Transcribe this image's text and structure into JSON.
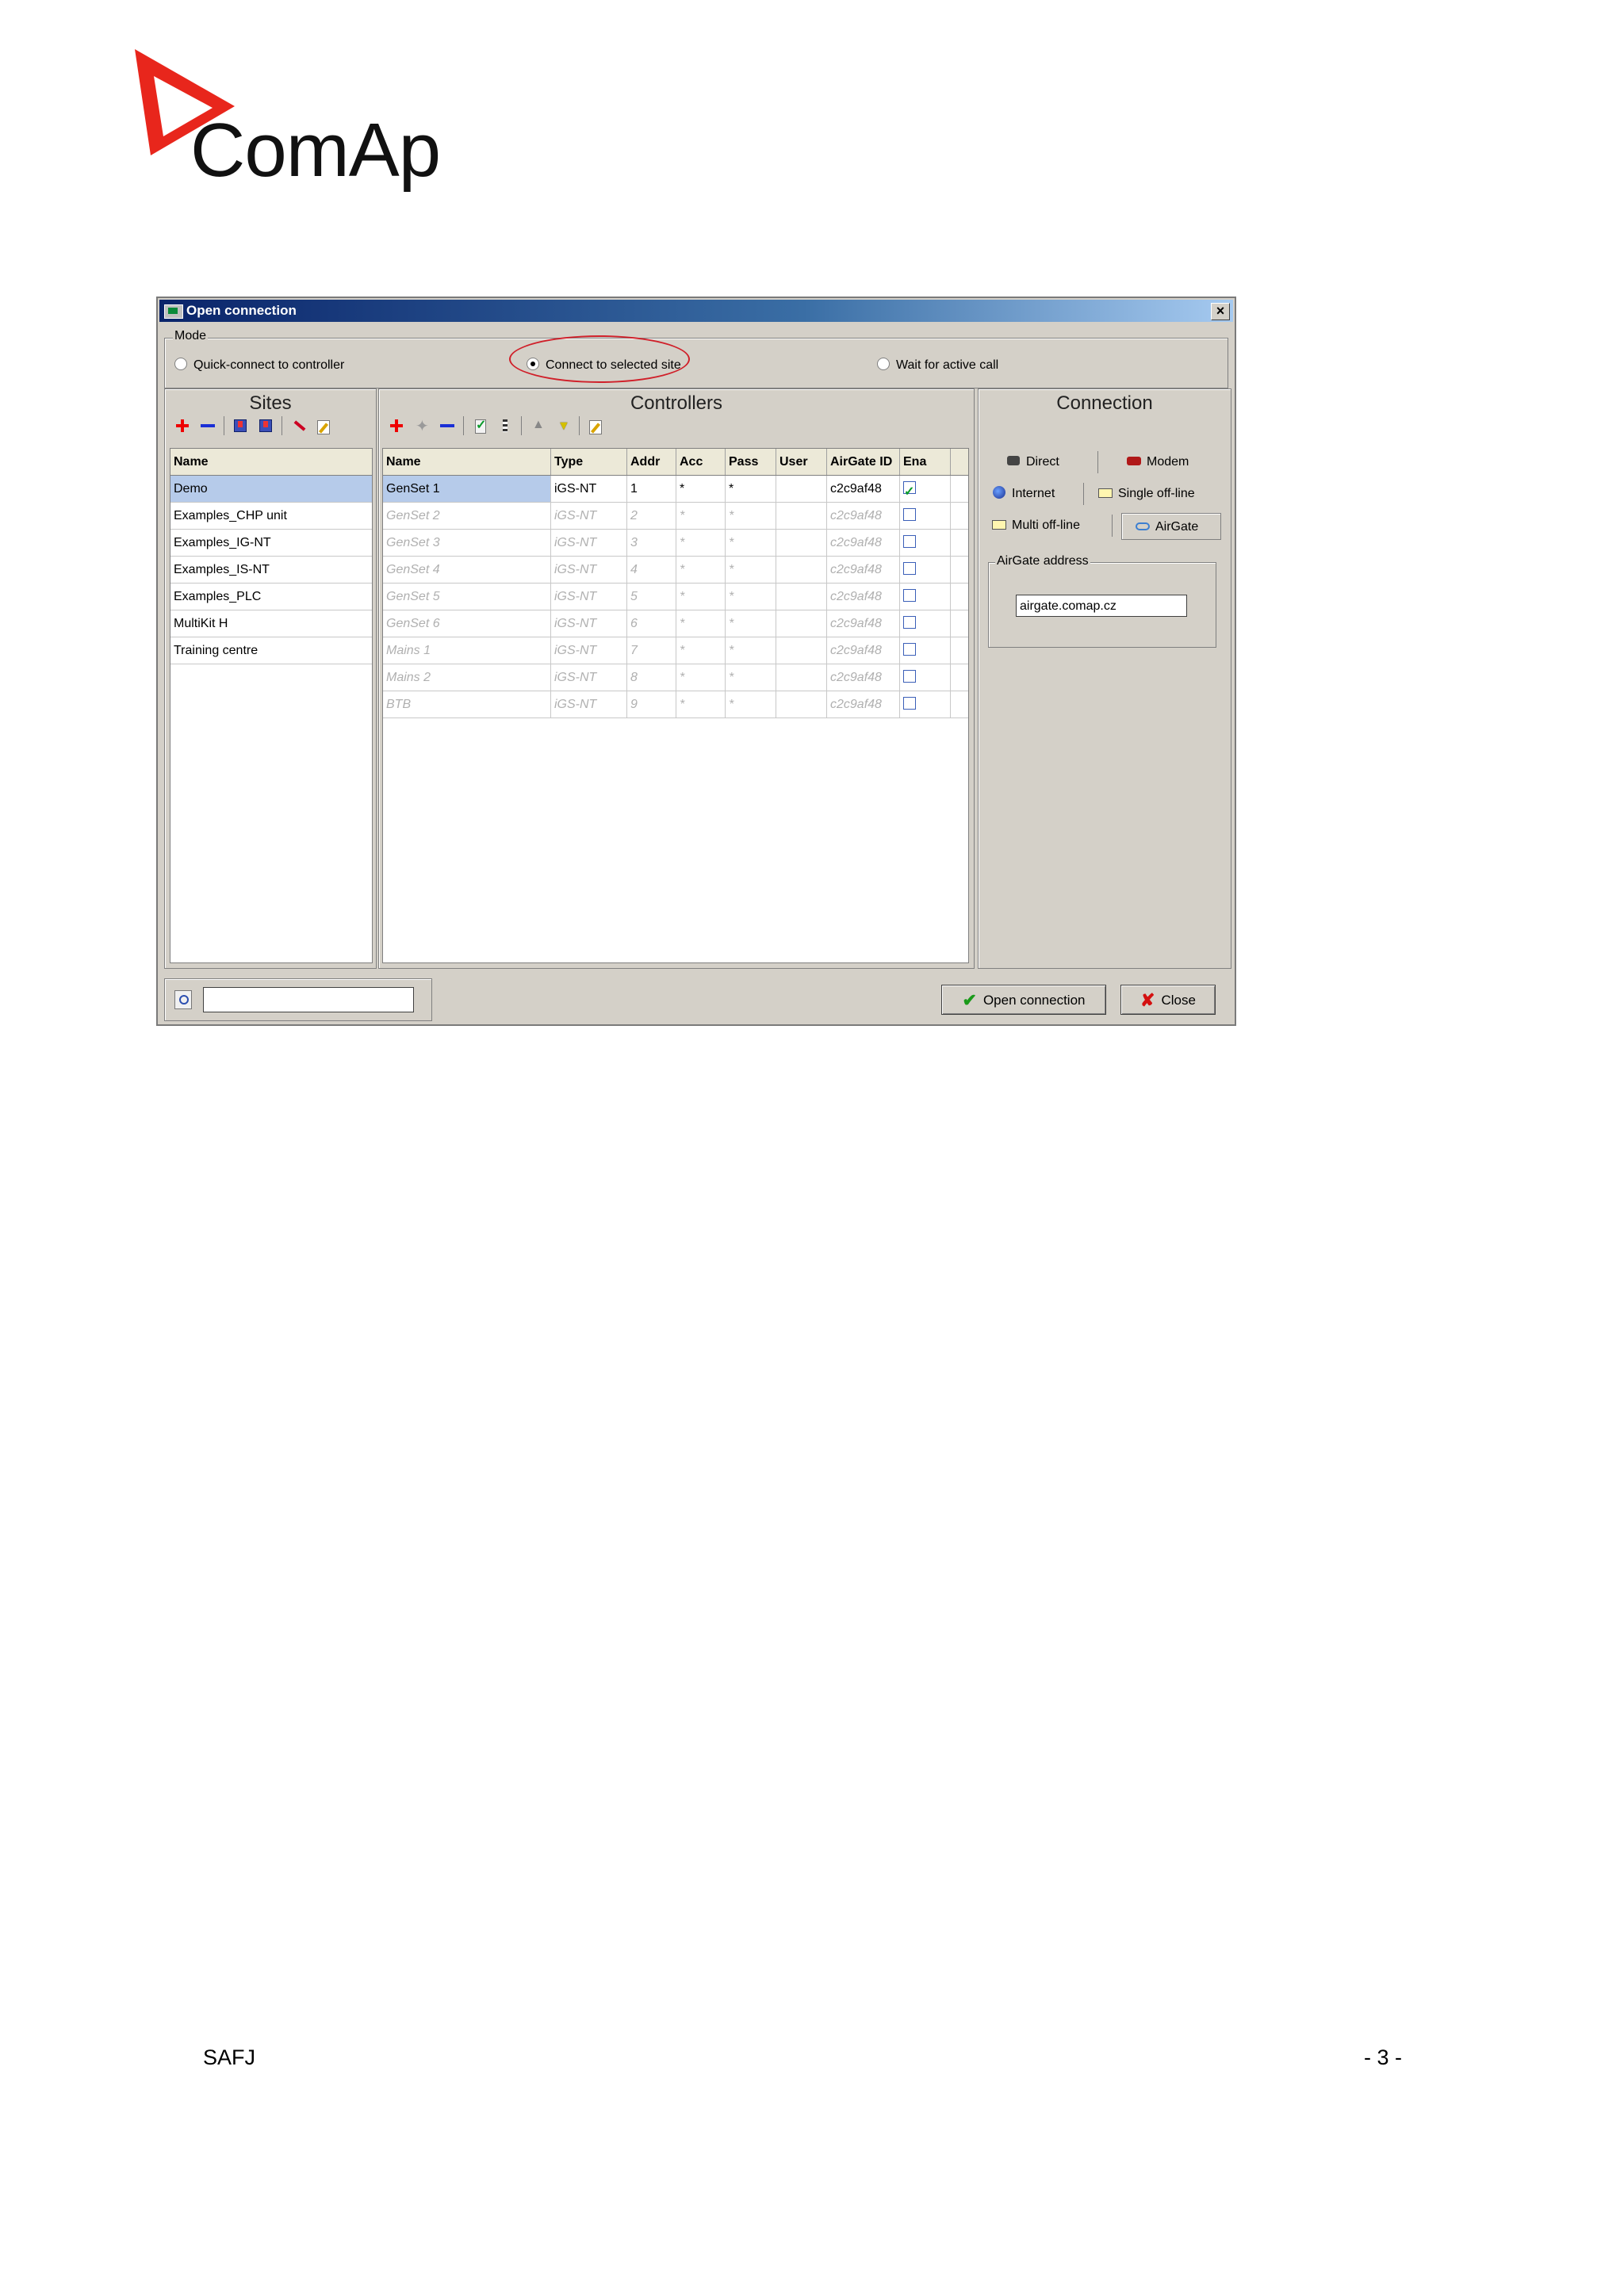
{
  "logo": {
    "text": "ComAp"
  },
  "dialog": {
    "title": "Open connection",
    "mode": {
      "legend": "Mode",
      "options": [
        {
          "label": "Quick-connect to controller",
          "selected": false
        },
        {
          "label": "Connect to selected site",
          "selected": true
        },
        {
          "label": "Wait for active call",
          "selected": false
        }
      ]
    },
    "sites": {
      "title": "Sites",
      "header": "Name",
      "items": [
        "Demo",
        "Examples_CHP unit",
        "Examples_IG-NT",
        "Examples_IS-NT",
        "Examples_PLC",
        "MultiKit H",
        "Training centre"
      ],
      "selected_index": 0
    },
    "controllers": {
      "title": "Controllers",
      "columns": [
        "Name",
        "Type",
        "Addr",
        "Acc",
        "Pass",
        "User",
        "AirGate ID",
        "Ena"
      ],
      "rows": [
        {
          "name": "GenSet 1",
          "type": "iGS-NT",
          "addr": "1",
          "acc": "*",
          "pass": "*",
          "user": "",
          "airgate": "c2c9af48",
          "ena": true
        },
        {
          "name": "GenSet 2",
          "type": "iGS-NT",
          "addr": "2",
          "acc": "*",
          "pass": "*",
          "user": "",
          "airgate": "c2c9af48",
          "ena": false
        },
        {
          "name": "GenSet 3",
          "type": "iGS-NT",
          "addr": "3",
          "acc": "*",
          "pass": "*",
          "user": "",
          "airgate": "c2c9af48",
          "ena": false
        },
        {
          "name": "GenSet 4",
          "type": "iGS-NT",
          "addr": "4",
          "acc": "*",
          "pass": "*",
          "user": "",
          "airgate": "c2c9af48",
          "ena": false
        },
        {
          "name": "GenSet 5",
          "type": "iGS-NT",
          "addr": "5",
          "acc": "*",
          "pass": "*",
          "user": "",
          "airgate": "c2c9af48",
          "ena": false
        },
        {
          "name": "GenSet 6",
          "type": "iGS-NT",
          "addr": "6",
          "acc": "*",
          "pass": "*",
          "user": "",
          "airgate": "c2c9af48",
          "ena": false
        },
        {
          "name": "Mains 1",
          "type": "iGS-NT",
          "addr": "7",
          "acc": "*",
          "pass": "*",
          "user": "",
          "airgate": "c2c9af48",
          "ena": false
        },
        {
          "name": "Mains 2",
          "type": "iGS-NT",
          "addr": "8",
          "acc": "*",
          "pass": "*",
          "user": "",
          "airgate": "c2c9af48",
          "ena": false
        },
        {
          "name": "BTB",
          "type": "iGS-NT",
          "addr": "9",
          "acc": "*",
          "pass": "*",
          "user": "",
          "airgate": "c2c9af48",
          "ena": false
        }
      ]
    },
    "connection": {
      "title": "Connection",
      "direct": "Direct",
      "modem": "Modem",
      "internet": "Internet",
      "single_offline": "Single off-line",
      "multi_offline": "Multi off-line",
      "airgate": "AirGate",
      "airgate_address_label": "AirGate address",
      "airgate_address": "airgate.comap.cz"
    },
    "buttons": {
      "open": "Open connection",
      "close": "Close"
    }
  },
  "footer": {
    "left": "SAFJ",
    "right": "- 3 -"
  }
}
